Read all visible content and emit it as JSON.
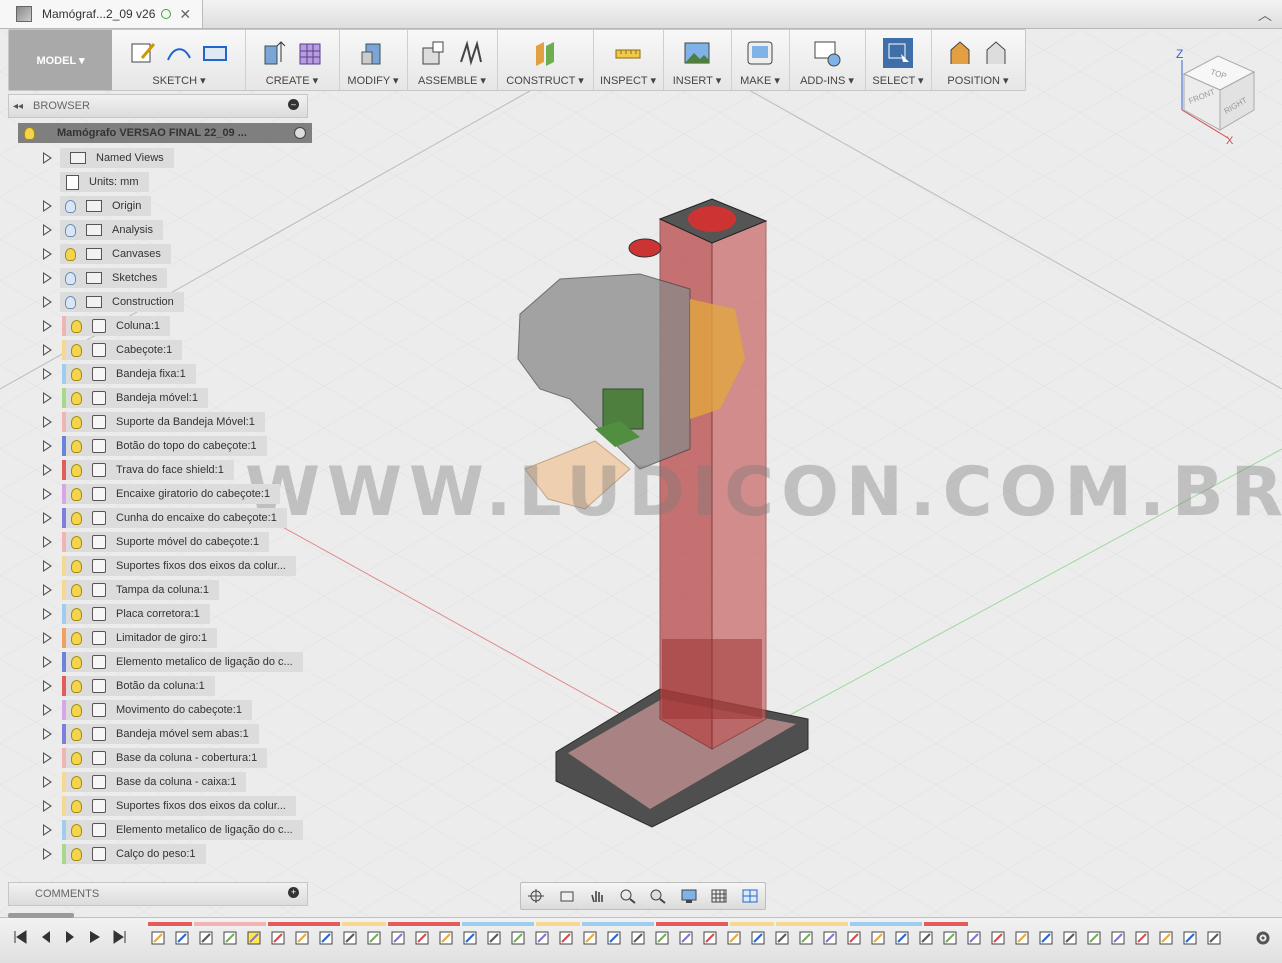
{
  "document_tab": {
    "title": "Mamógraf...2_09 v26"
  },
  "toolbar": {
    "workspace": "MODEL ▾",
    "groups": [
      {
        "label": "SKETCH ▾"
      },
      {
        "label": "CREATE ▾"
      },
      {
        "label": "MODIFY ▾"
      },
      {
        "label": "ASSEMBLE ▾"
      },
      {
        "label": "CONSTRUCT ▾"
      },
      {
        "label": "INSPECT ▾"
      },
      {
        "label": "INSERT ▾"
      },
      {
        "label": "MAKE ▾"
      },
      {
        "label": "ADD-INS ▾"
      },
      {
        "label": "SELECT ▾"
      },
      {
        "label": "POSITION ▾"
      }
    ]
  },
  "browser": {
    "title": "BROWSER",
    "root": "Mamógrafo VERSAO FINAL 22_09 ...",
    "rows": [
      {
        "label": "Named Views",
        "kind": "folder",
        "bulb": "none",
        "color": ""
      },
      {
        "label": "Units: mm",
        "kind": "units",
        "bulb": "none",
        "color": ""
      },
      {
        "label": "Origin",
        "kind": "folder",
        "bulb": "off",
        "color": ""
      },
      {
        "label": "Analysis",
        "kind": "folder",
        "bulb": "off",
        "color": ""
      },
      {
        "label": "Canvases",
        "kind": "folder",
        "bulb": "on",
        "color": ""
      },
      {
        "label": "Sketches",
        "kind": "folder",
        "bulb": "off",
        "color": ""
      },
      {
        "label": "Construction",
        "kind": "folder",
        "bulb": "off",
        "color": ""
      },
      {
        "label": "Coluna:1",
        "kind": "component",
        "bulb": "on",
        "color": "#f2b3b3"
      },
      {
        "label": "Cabeçote:1",
        "kind": "component",
        "bulb": "on",
        "color": "#f6d98f"
      },
      {
        "label": "Bandeja fixa:1",
        "kind": "component",
        "bulb": "on",
        "color": "#9fcdf0"
      },
      {
        "label": "Bandeja móvel:1",
        "kind": "component",
        "bulb": "on",
        "color": "#a6d98a"
      },
      {
        "label": "Suporte da Bandeja Móvel:1",
        "kind": "component",
        "bulb": "on",
        "color": "#f2b3b3"
      },
      {
        "label": "Botão do topo do cabeçote:1",
        "kind": "component",
        "bulb": "on",
        "color": "#6b84d9"
      },
      {
        "label": "Trava do face shield:1",
        "kind": "component",
        "bulb": "on",
        "color": "#e35b5b"
      },
      {
        "label": "Encaixe giratorio do cabeçote:1",
        "kind": "component",
        "bulb": "on",
        "color": "#d8a6e6"
      },
      {
        "label": "Cunha do encaixe do cabeçote:1",
        "kind": "component",
        "bulb": "on",
        "color": "#7d7fdc"
      },
      {
        "label": "Suporte móvel do cabeçote:1",
        "kind": "component",
        "bulb": "on",
        "color": "#f2b3b3"
      },
      {
        "label": "Suportes fixos dos eixos da colur...",
        "kind": "component",
        "bulb": "on",
        "color": "#f6d98f"
      },
      {
        "label": "Tampa da coluna:1",
        "kind": "component",
        "bulb": "on",
        "color": "#f6d98f"
      },
      {
        "label": "Placa corretora:1",
        "kind": "component",
        "bulb": "on",
        "color": "#9fcdf0"
      },
      {
        "label": "Limitador de giro:1",
        "kind": "component",
        "bulb": "on",
        "color": "#f0a060"
      },
      {
        "label": "Elemento metalico de ligação do c...",
        "kind": "component",
        "bulb": "on",
        "color": "#6b84d9"
      },
      {
        "label": "Botão da coluna:1",
        "kind": "component",
        "bulb": "on",
        "color": "#e35b5b"
      },
      {
        "label": "Movimento do cabeçote:1",
        "kind": "component",
        "bulb": "on",
        "color": "#d8a6e6"
      },
      {
        "label": "Bandeja móvel sem abas:1",
        "kind": "component",
        "bulb": "on",
        "color": "#7d7fdc"
      },
      {
        "label": "Base da coluna - cobertura:1",
        "kind": "component",
        "bulb": "on",
        "color": "#f2b3b3"
      },
      {
        "label": "Base da coluna - caixa:1",
        "kind": "component",
        "bulb": "on",
        "color": "#f6d98f"
      },
      {
        "label": "Suportes fixos dos eixos da colur...",
        "kind": "component",
        "bulb": "on",
        "color": "#f6d98f"
      },
      {
        "label": "Elemento metalico de ligação do c...",
        "kind": "component",
        "bulb": "on",
        "color": "#9fcdf0"
      },
      {
        "label": "Calço do peso:1",
        "kind": "component",
        "bulb": "on",
        "color": "#a6d98a"
      }
    ]
  },
  "comments": {
    "title": "COMMENTS"
  },
  "viewport": {
    "watermark": "WWW.LUDICON.COM.BR"
  },
  "viewcube": {
    "top": "TOP",
    "front": "FRONT",
    "right": "RIGHT",
    "z": "Z",
    "x": "X"
  },
  "colors": {
    "accent": "#0696d7",
    "selected": "#3f6fa8",
    "column_red": "#c0392b"
  }
}
